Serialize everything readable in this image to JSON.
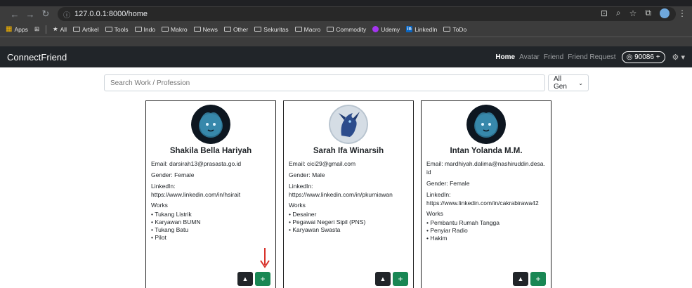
{
  "browser": {
    "url": "127.0.0.1:8000/home",
    "bookmarks": [
      "Apps",
      "All",
      "Artikel",
      "Tools",
      "Indo",
      "Makro",
      "News",
      "Other",
      "Sekuritas",
      "Macro",
      "Commodity",
      "Udemy",
      "LinkedIn",
      "ToDo"
    ]
  },
  "navbar": {
    "brand": "ConnectFriend",
    "links": [
      "Home",
      "Avatar",
      "Friend",
      "Friend Request"
    ],
    "coins": "90086 +"
  },
  "search": {
    "placeholder": "Search Work / Profession",
    "gender_filter": "All Gen"
  },
  "colors": {
    "navbar": "#212529",
    "add": "#198754",
    "arrow": "#d8312a"
  },
  "cards": [
    {
      "name": "Shakila Bella Hariyah",
      "email": "Email: darsirah13@prasasta.go.id",
      "gender": "Gender: Female",
      "linkedin_label": "LinkedIn:",
      "linkedin": "https://www.linkedin.com/in/hsirait",
      "works_label": "Works",
      "works": [
        "Tukang Listrik",
        "Karyawan BUMN",
        "Tukang Batu",
        "Pilot"
      ],
      "avatar": "lion-avatar"
    },
    {
      "name": "Sarah Ifa Winarsih",
      "email": "Email: cici29@gmail.com",
      "gender": "Gender: Male",
      "linkedin_label": "LinkedIn:",
      "linkedin": "https://www.linkedin.com/in/pkurniawan",
      "works_label": "Works",
      "works": [
        "Desainer",
        "Pegawai Negeri Sipil (PNS)",
        "Karyawan Swasta"
      ],
      "avatar": "dragon-avatar"
    },
    {
      "name": "Intan Yolanda M.M.",
      "email": "Email: mardhiyah.dalima@nashiruddin.desa.id",
      "gender": "Gender: Female",
      "linkedin_label": "LinkedIn:",
      "linkedin": "https://www.linkedin.com/in/cakrabirawa42",
      "works_label": "Works",
      "works": [
        "Pembantu Rumah Tangga",
        "Penyiar Radio",
        "Hakim"
      ],
      "avatar": "lion-avatar"
    }
  ]
}
